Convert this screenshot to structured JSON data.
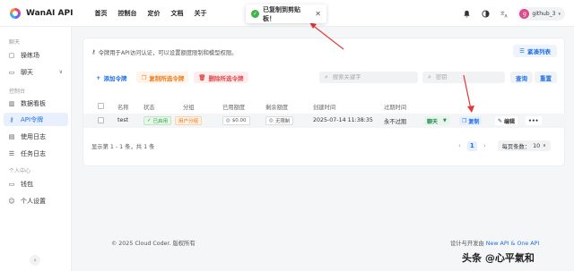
{
  "brand": {
    "name": "WanAI API"
  },
  "topnav": [
    "首页",
    "控制台",
    "定价",
    "文档",
    "关于"
  ],
  "toast": {
    "message": "已复制到剪贴板！"
  },
  "user": {
    "avatar": "g",
    "name": "github_3"
  },
  "sidebar": {
    "sections": [
      {
        "title": "聊天",
        "items": [
          {
            "label": "操练场",
            "icon": "playground-icon"
          },
          {
            "label": "聊天",
            "icon": "chat-icon",
            "expandable": true
          }
        ]
      },
      {
        "title": "控制台",
        "items": [
          {
            "label": "数据看板",
            "icon": "dashboard-icon"
          },
          {
            "label": "API令牌",
            "icon": "key-icon",
            "active": true
          },
          {
            "label": "使用日志",
            "icon": "log-icon"
          },
          {
            "label": "任务日志",
            "icon": "task-icon"
          }
        ]
      },
      {
        "title": "个人中心",
        "items": [
          {
            "label": "钱包",
            "icon": "wallet-icon"
          },
          {
            "label": "个人设置",
            "icon": "user-icon"
          }
        ]
      }
    ]
  },
  "card": {
    "description": "令牌用于API访问认证，可以设置额度限制和模型权限。",
    "compact_label": "紧凑列表",
    "actions": {
      "add": "添加令牌",
      "copy_selected": "复制所选令牌",
      "delete_selected": "删除所选令牌"
    },
    "search": {
      "keyword_placeholder": "搜索关键字",
      "key_placeholder": "密钥",
      "query": "查询",
      "reset": "重置"
    },
    "columns": [
      "名称",
      "状态",
      "分组",
      "已用额度",
      "剩余额度",
      "创建时间",
      "过期时间"
    ],
    "rows": [
      {
        "name": "test",
        "status": "已启用",
        "group": "用户分组",
        "used": "$0.00",
        "remaining": "无限制",
        "created": "2025-07-14 11:38:35",
        "expires": "永不过期",
        "btn_chat": "聊天",
        "btn_copy": "复制",
        "btn_edit": "编辑"
      }
    ],
    "footer": {
      "summary": "显示第 1 - 1 条，共 1 条",
      "current_page": "1",
      "page_size_label": "每页条数：",
      "page_size": "10"
    }
  },
  "footer": {
    "copyright": "© 2025 Cloud Coder. 版权所有",
    "designed_prefix": "设计与开发由",
    "link1": "New API",
    "amp": "&",
    "link2": "One API"
  },
  "watermark": "头条 @心平氣和",
  "colors": {
    "primary": "#1f6fe5",
    "active_bg": "#e9f0fd",
    "success": "#3bb54a",
    "annotation_arrow": "#e53935"
  }
}
